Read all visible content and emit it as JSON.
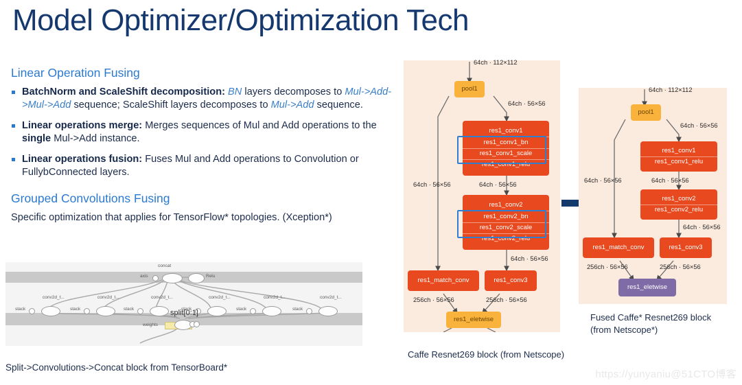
{
  "slide": {
    "title": "Model Optimizer/Optimization Tech",
    "title_color": "#15386e",
    "accent_blue": "#2b7ad1",
    "node_red": "#e8491e",
    "node_amber": "#f9b23c",
    "node_purple": "#7f6ba6",
    "panel_bg": "#fbeade",
    "highlight_box_color": "#2f7fd0",
    "arrow_color": "#14396d"
  },
  "sections": [
    {
      "heading": "Linear Operation Fusing",
      "bullets": [
        {
          "parts": [
            {
              "text": "BatchNorm and ScaleShift decomposition:",
              "style": "bold"
            },
            {
              "text": " ",
              "style": "plain"
            },
            {
              "text": "BN",
              "style": "italic"
            },
            {
              "text": " layers decomposes to ",
              "style": "plain"
            },
            {
              "text": "Mul->Add->Mul->Add",
              "style": "italic"
            },
            {
              "text": " sequence; ScaleShift layers decomposes to ",
              "style": "plain"
            },
            {
              "text": "Mul->Add",
              "style": "italic"
            },
            {
              "text": " sequence.",
              "style": "plain"
            }
          ]
        },
        {
          "parts": [
            {
              "text": "Linear operations merge:",
              "style": "bold"
            },
            {
              "text": " Merges sequences of Mul and Add operations to the ",
              "style": "plain"
            },
            {
              "text": "single",
              "style": "bold"
            },
            {
              "text": " Mul->Add instance.",
              "style": "plain"
            }
          ]
        },
        {
          "parts": [
            {
              "text": "Linear operations fusion:",
              "style": "bold"
            },
            {
              "text": " Fuses Mul and Add operations to Convolution or FullybConnected layers.",
              "style": "plain"
            }
          ]
        }
      ]
    },
    {
      "heading": "Grouped Convolutions Fusing",
      "body": "Specific optimization that applies for TensorFlow* topologies. (Xception*)"
    }
  ],
  "tensorboard": {
    "caption": "Split->Convolutions->Concat block from TensorBoard*",
    "labels": {
      "concat": "concat",
      "axis": "axis",
      "relu": "Relu",
      "split": "split[0:1]",
      "weights": "weights",
      "stack": "stack",
      "conv": "conv2d_t..."
    },
    "conv_count": 6
  },
  "diagram_left": {
    "caption": "Caffe Resnet269 block (from Netscope)",
    "nodes": [
      {
        "id": "pool1",
        "label": "pool1",
        "kind": "amber"
      },
      {
        "id": "res1_conv1",
        "rows": [
          "res1_conv1",
          "res1_conv1_bn",
          "res1_conv1_scale",
          "res1_conv1_relu"
        ],
        "kind": "red"
      },
      {
        "id": "res1_conv2",
        "rows": [
          "res1_conv2",
          "res1_conv2_bn",
          "res1_conv2_scale",
          "res1_conv2_relu"
        ],
        "kind": "red"
      },
      {
        "id": "res1_match_conv",
        "label": "res1_match_conv",
        "kind": "red"
      },
      {
        "id": "res1_conv3",
        "label": "res1_conv3",
        "kind": "red"
      },
      {
        "id": "res1_eletwise",
        "label": "res1_eletwise",
        "kind": "amber"
      }
    ],
    "dims": {
      "top": "64ch · 112×112",
      "pool_out": "64ch · 56×56",
      "skip1": "64ch · 56×56",
      "conv1_out": "64ch · 56×56",
      "conv2_out": "64ch · 56×56",
      "match_out": "256ch · 56×56",
      "conv3_out": "256ch · 56×56"
    }
  },
  "diagram_right": {
    "caption": "Fused Caffe* Resnet269 block (from Netscope*)",
    "nodes": [
      {
        "id": "pool1",
        "label": "pool1",
        "kind": "amber"
      },
      {
        "id": "res1_conv1",
        "rows": [
          "res1_conv1",
          "res1_conv1_relu"
        ],
        "kind": "red"
      },
      {
        "id": "res1_conv2",
        "rows": [
          "res1_conv2",
          "res1_conv2_relu"
        ],
        "kind": "red"
      },
      {
        "id": "res1_match_conv",
        "label": "res1_match_conv",
        "kind": "red"
      },
      {
        "id": "res1_conv3",
        "label": "res1_conv3",
        "kind": "red"
      },
      {
        "id": "res1_eletwise",
        "label": "res1_eletwise",
        "kind": "purple"
      }
    ],
    "dims": {
      "top": "64ch · 112×112",
      "pool_out": "64ch · 56×56",
      "skip1": "64ch · 56×56",
      "conv1_out": "64ch · 56×56",
      "conv2_out": "64ch · 56×56",
      "match_out": "256ch · 56×56",
      "conv3_out": "256ch · 56×56"
    }
  },
  "watermark": "https://yunyaniu@51CTO博客"
}
